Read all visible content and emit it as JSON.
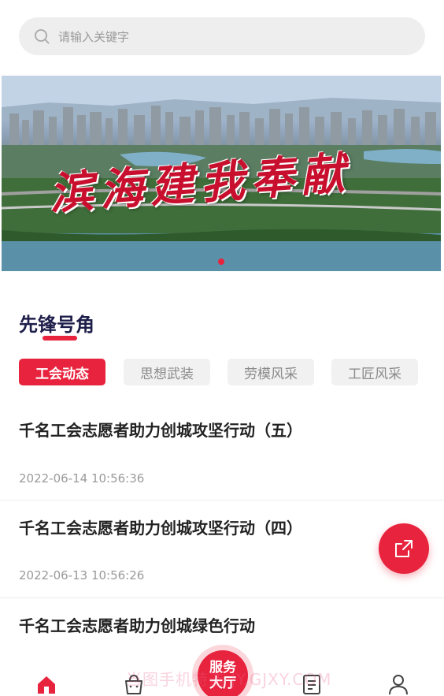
{
  "search": {
    "placeholder": "请输入关键字"
  },
  "banner": {
    "calligraphy": "滨海建我奉献",
    "slide_count": 1,
    "active_slide": 1
  },
  "section": {
    "title": "先锋号角"
  },
  "tabs": [
    {
      "label": "工会动态",
      "active": true
    },
    {
      "label": "思想武装",
      "active": false
    },
    {
      "label": "劳模风采",
      "active": false
    },
    {
      "label": "工匠风采",
      "active": false
    }
  ],
  "news": [
    {
      "title": "千名工会志愿者助力创城攻坚行动（五）",
      "date": "2022-06-14 10:56:36"
    },
    {
      "title": "千名工会志愿者助力创城攻坚行动（四）",
      "date": "2022-06-13 10:56:26"
    },
    {
      "title": "千名工会志愿者助力创城绿色行动",
      "date": ""
    }
  ],
  "fab": {
    "icon": "share-icon"
  },
  "bottom_nav": {
    "items": [
      {
        "icon": "home-icon",
        "active": true
      },
      {
        "icon": "shopping-bag-icon",
        "active": false
      },
      {
        "icon": "news-icon",
        "active": false
      },
      {
        "icon": "user-icon",
        "active": false
      }
    ],
    "center": {
      "line1": "服务",
      "line2": "大厅"
    }
  },
  "watermark": "当图手机特选  JY.GJXY.COM",
  "colors": {
    "accent": "#e8233e",
    "title": "#1e1e4a",
    "muted": "#9a9a9a"
  }
}
